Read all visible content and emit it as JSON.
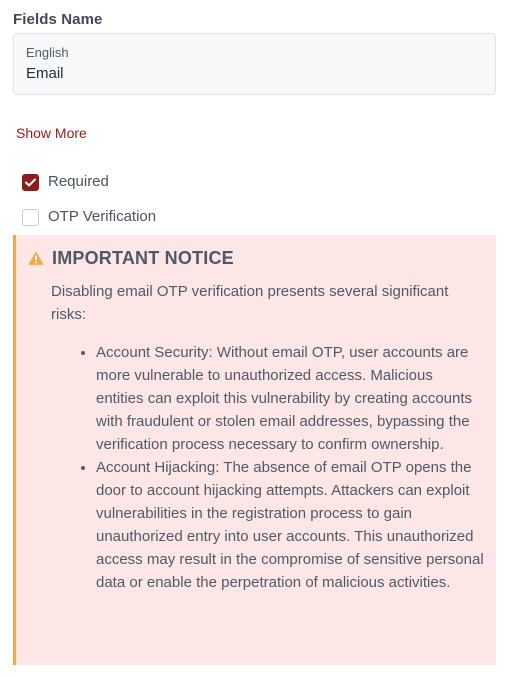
{
  "field": {
    "section_title": "Fields Name",
    "language": "English",
    "value": "Email"
  },
  "show_more_label": "Show More",
  "options": {
    "required": {
      "label": "Required",
      "checked": true
    },
    "otp": {
      "label": "OTP Verification",
      "checked": false
    }
  },
  "notice": {
    "icon": "warning-triangle-icon",
    "title": "IMPORTANT NOTICE",
    "intro": "Disabling email OTP verification presents several significant risks:",
    "items": [
      "Account Security: Without email OTP, user accounts are more vulnerable to unauthorized access. Malicious entities can exploit this vulnerability by creating accounts with fraudulent or stolen email addresses, bypassing the verification process necessary to confirm ownership.",
      "Account Hijacking: The absence of email OTP opens the door to account hijacking attempts. Attackers can exploit vulnerabilities in the registration process to gain unauthorized entry into user accounts. This unauthorized access may result in the compromise of sensitive personal data or enable the perpetration of malicious activities."
    ]
  },
  "colors": {
    "accent": "#8e1c1c",
    "notice_bg": "#fce6e6",
    "notice_border": "#f6a74b",
    "warning_icon": "#f6a74b"
  }
}
